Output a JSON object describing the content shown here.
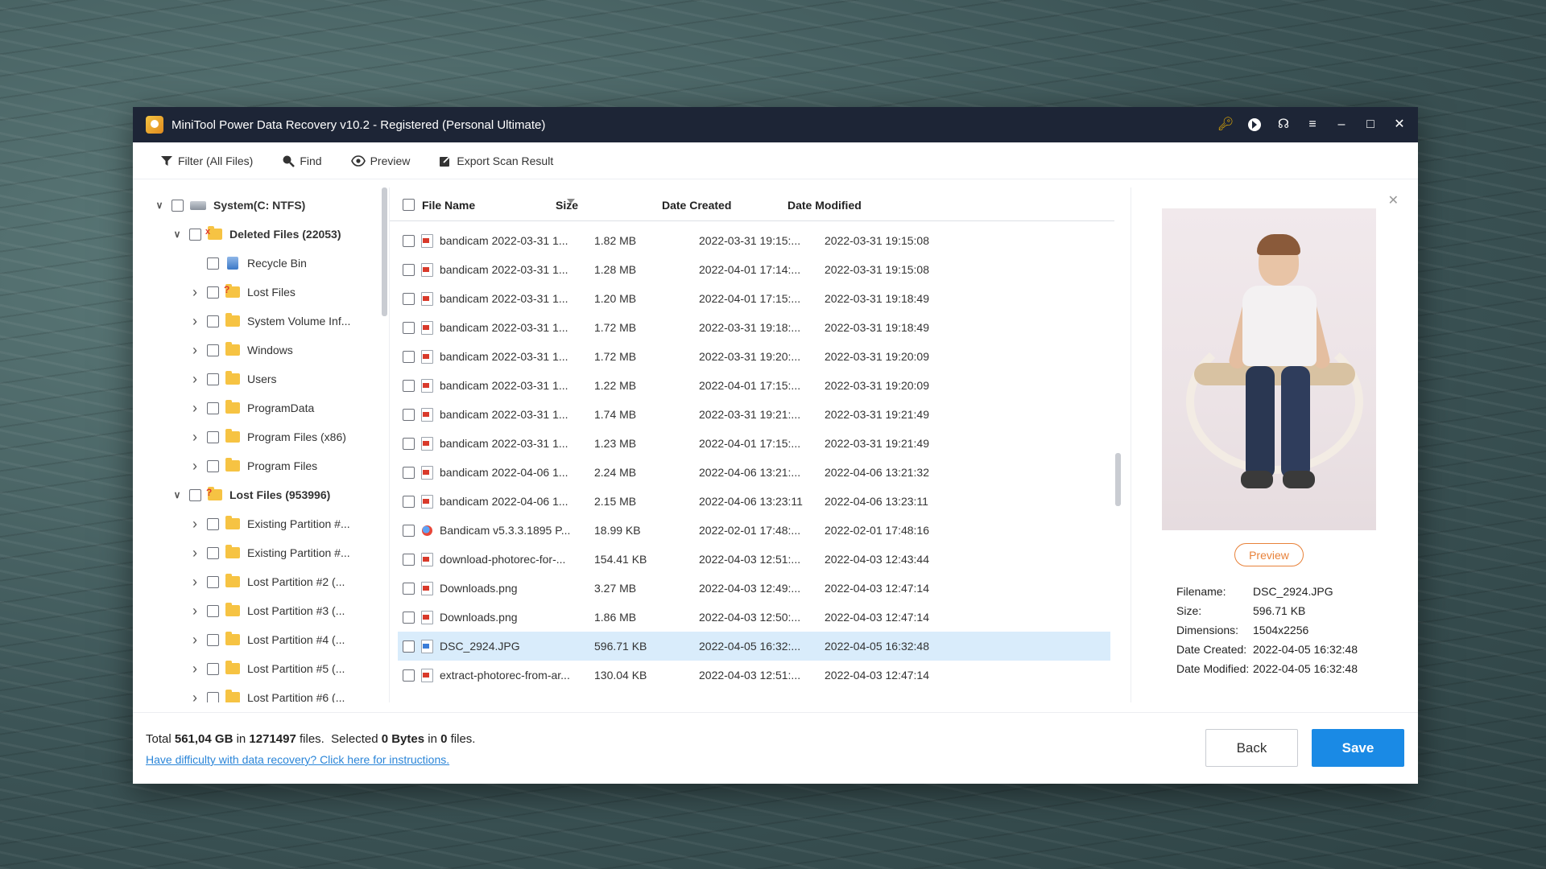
{
  "window": {
    "title": "MiniTool Power Data Recovery v10.2 - Registered (Personal Ultimate)"
  },
  "toolbar": {
    "filter_label": "Filter (All Files)",
    "find_label": "Find",
    "preview_label": "Preview",
    "export_label": "Export Scan Result"
  },
  "tree": [
    {
      "label": "System(C: NTFS)",
      "level": 0,
      "expanded": true,
      "icon": "drive-icon",
      "bold": true
    },
    {
      "label": "Deleted Files (22053)",
      "level": 1,
      "expanded": true,
      "icon": "deleted-folder-icon",
      "bold": true
    },
    {
      "label": "Recycle Bin",
      "level": 2,
      "icon": "recycle-bin-icon"
    },
    {
      "label": "Lost Files",
      "level": 2,
      "icon": "lost-folder-icon"
    },
    {
      "label": "System Volume Inf...",
      "level": 2,
      "icon": "folder-icon"
    },
    {
      "label": "Windows",
      "level": 2,
      "icon": "folder-icon"
    },
    {
      "label": "Users",
      "level": 2,
      "icon": "folder-icon"
    },
    {
      "label": "ProgramData",
      "level": 2,
      "icon": "folder-icon"
    },
    {
      "label": "Program Files (x86)",
      "level": 2,
      "icon": "folder-icon"
    },
    {
      "label": "Program Files",
      "level": 2,
      "icon": "folder-icon"
    },
    {
      "label": "Lost Files (953996)",
      "level": 1,
      "expanded": true,
      "icon": "lost-folder-icon",
      "bold": true
    },
    {
      "label": "Existing Partition #...",
      "level": 2,
      "icon": "folder-icon"
    },
    {
      "label": "Existing Partition #...",
      "level": 2,
      "icon": "folder-icon"
    },
    {
      "label": "Lost Partition #2 (...",
      "level": 2,
      "icon": "folder-icon"
    },
    {
      "label": "Lost Partition #3 (...",
      "level": 2,
      "icon": "folder-icon"
    },
    {
      "label": "Lost Partition #4 (...",
      "level": 2,
      "icon": "folder-icon"
    },
    {
      "label": "Lost Partition #5 (...",
      "level": 2,
      "icon": "folder-icon"
    },
    {
      "label": "Lost Partition #6 (...",
      "level": 2,
      "icon": "folder-icon"
    }
  ],
  "list": {
    "columns": [
      "File Name",
      "Size",
      "Date Created",
      "Date Modified"
    ],
    "rows": [
      {
        "name": "bandicam 2022-03-31 1...",
        "size": "1.82 MB",
        "created": "2022-03-31 19:15:...",
        "modified": "2022-03-31 19:15:08",
        "icon": "image-file-icon"
      },
      {
        "name": "bandicam 2022-03-31 1...",
        "size": "1.28 MB",
        "created": "2022-04-01 17:14:...",
        "modified": "2022-03-31 19:15:08",
        "icon": "image-file-icon"
      },
      {
        "name": "bandicam 2022-03-31 1...",
        "size": "1.20 MB",
        "created": "2022-04-01 17:15:...",
        "modified": "2022-03-31 19:18:49",
        "icon": "image-file-icon"
      },
      {
        "name": "bandicam 2022-03-31 1...",
        "size": "1.72 MB",
        "created": "2022-03-31 19:18:...",
        "modified": "2022-03-31 19:18:49",
        "icon": "image-file-icon"
      },
      {
        "name": "bandicam 2022-03-31 1...",
        "size": "1.72 MB",
        "created": "2022-03-31 19:20:...",
        "modified": "2022-03-31 19:20:09",
        "icon": "image-file-icon"
      },
      {
        "name": "bandicam 2022-03-31 1...",
        "size": "1.22 MB",
        "created": "2022-04-01 17:15:...",
        "modified": "2022-03-31 19:20:09",
        "icon": "image-file-icon"
      },
      {
        "name": "bandicam 2022-03-31 1...",
        "size": "1.74 MB",
        "created": "2022-03-31 19:21:...",
        "modified": "2022-03-31 19:21:49",
        "icon": "image-file-icon"
      },
      {
        "name": "bandicam 2022-03-31 1...",
        "size": "1.23 MB",
        "created": "2022-04-01 17:15:...",
        "modified": "2022-03-31 19:21:49",
        "icon": "image-file-icon"
      },
      {
        "name": "bandicam 2022-04-06 1...",
        "size": "2.24 MB",
        "created": "2022-04-06 13:21:...",
        "modified": "2022-04-06 13:21:32",
        "icon": "image-file-icon"
      },
      {
        "name": "bandicam 2022-04-06 1...",
        "size": "2.15 MB",
        "created": "2022-04-06 13:23:11",
        "modified": "2022-04-06 13:23:11",
        "icon": "image-file-icon"
      },
      {
        "name": "Bandicam v5.3.3.1895 P...",
        "size": "18.99 KB",
        "created": "2022-02-01 17:48:...",
        "modified": "2022-02-01 17:48:16",
        "icon": "app-file-icon"
      },
      {
        "name": "download-photorec-for-...",
        "size": "154.41 KB",
        "created": "2022-04-03 12:51:...",
        "modified": "2022-04-03 12:43:44",
        "icon": "image-file-icon"
      },
      {
        "name": "Downloads.png",
        "size": "3.27 MB",
        "created": "2022-04-03 12:49:...",
        "modified": "2022-04-03 12:47:14",
        "icon": "image-file-icon"
      },
      {
        "name": "Downloads.png",
        "size": "1.86 MB",
        "created": "2022-04-03 12:50:...",
        "modified": "2022-04-03 12:47:14",
        "icon": "image-file-icon"
      },
      {
        "name": "DSC_2924.JPG",
        "size": "596.71 KB",
        "created": "2022-04-05 16:32:...",
        "modified": "2022-04-05 16:32:48",
        "icon": "jpg-file-icon",
        "selected": true
      },
      {
        "name": "extract-photorec-from-ar...",
        "size": "130.04 KB",
        "created": "2022-04-03 12:51:...",
        "modified": "2022-04-03 12:47:14",
        "icon": "image-file-icon"
      }
    ]
  },
  "preview": {
    "button_label": "Preview",
    "filename_key": "Filename:",
    "filename": "DSC_2924.JPG",
    "size_key": "Size:",
    "size": "596.71 KB",
    "dimensions_key": "Dimensions:",
    "dimensions": "1504x2256",
    "created_key": "Date Created:",
    "created": "2022-04-05 16:32:48",
    "modified_key": "Date Modified:",
    "modified": "2022-04-05 16:32:48"
  },
  "footer": {
    "total_prefix": "Total ",
    "total_size": "561,04 GB",
    "in_word": " in ",
    "total_files": "1271497",
    "files_word": " files.  Selected ",
    "selected_size": "0 Bytes",
    "in_word2": " in ",
    "selected_files": "0",
    "files_word2": " files.",
    "help_link": "Have difficulty with data recovery? Click here for instructions.",
    "back_label": "Back",
    "save_label": "Save"
  },
  "colors": {
    "titlebar": "#1d2536",
    "accent_blue": "#1a8ae5",
    "preview_orange": "#e8823a",
    "selected_row": "#d9ecfb",
    "folder_yellow": "#f6c343"
  }
}
